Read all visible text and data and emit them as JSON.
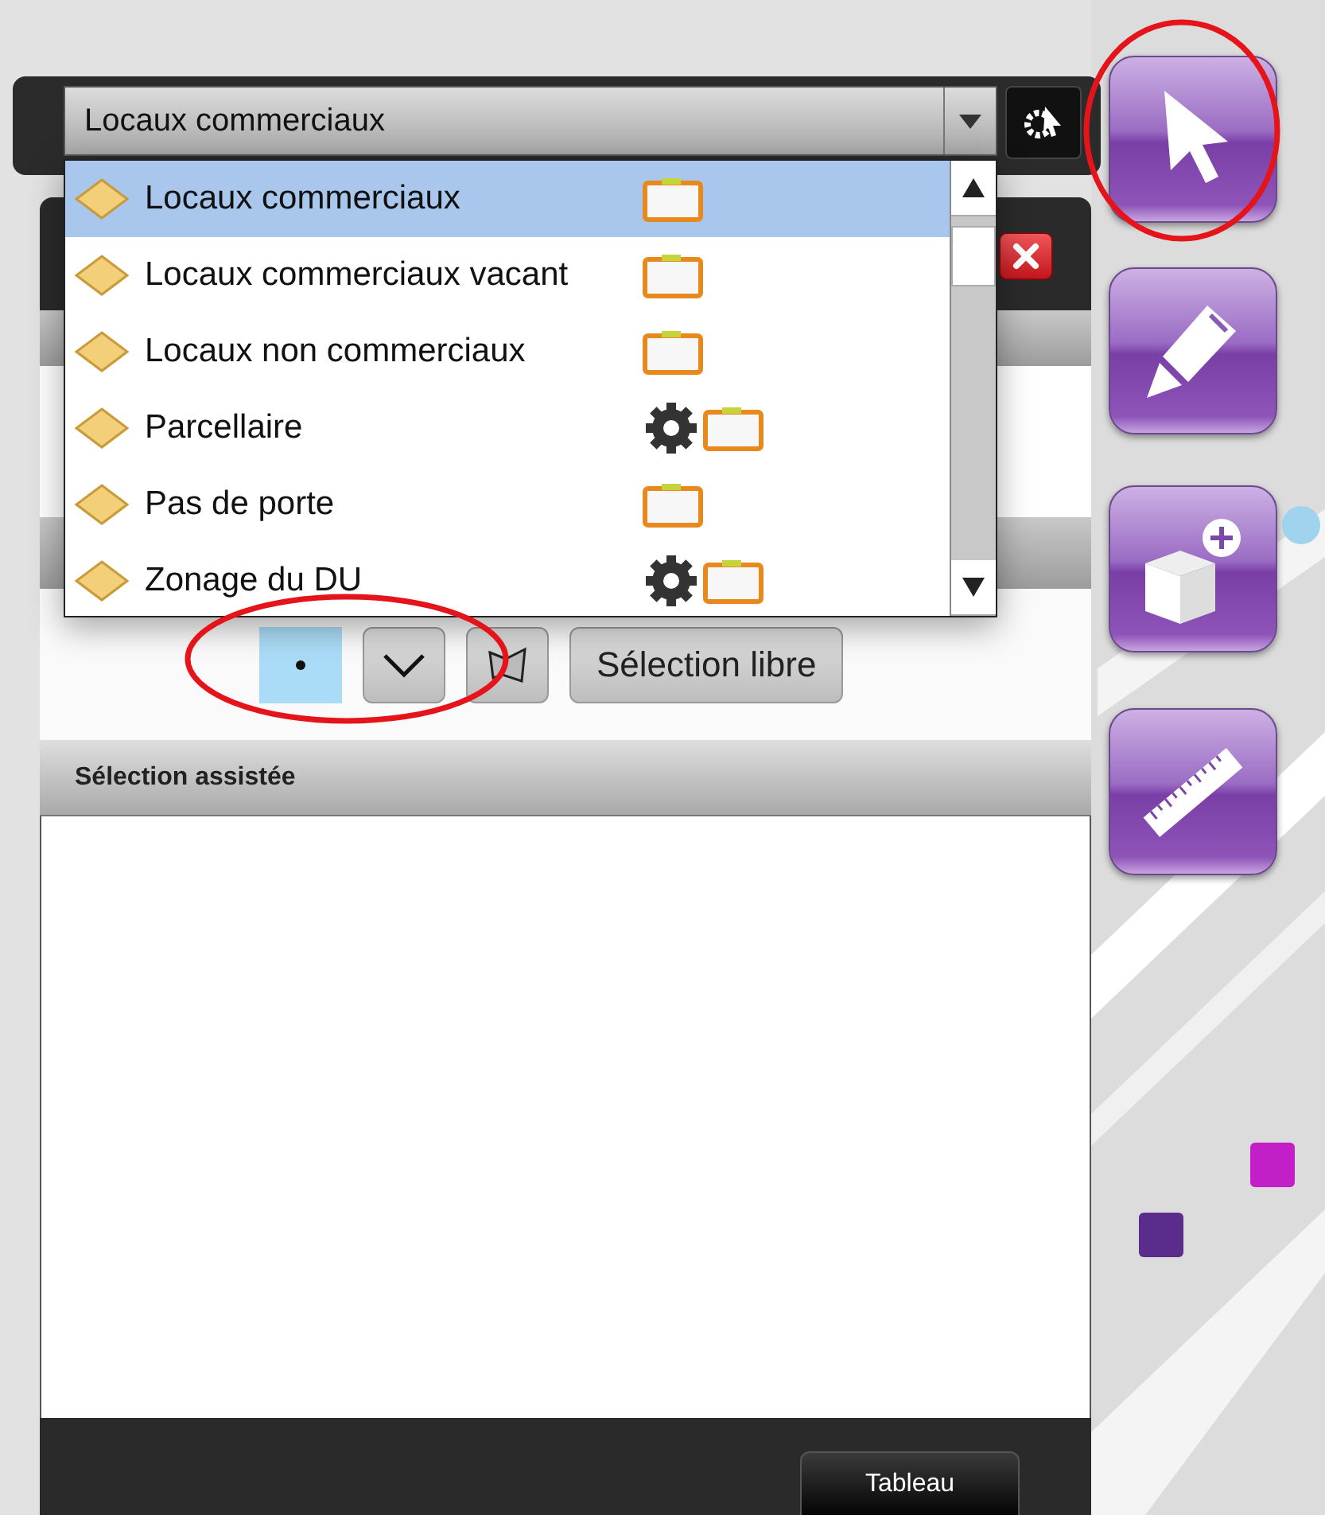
{
  "layer_select": {
    "value": "Locaux commerciaux"
  },
  "layer_list": {
    "items": [
      {
        "label": "Locaux commerciaux",
        "selected": true,
        "settings": false
      },
      {
        "label": "Locaux commerciaux vacant",
        "selected": false,
        "settings": false
      },
      {
        "label": "Locaux non commerciaux",
        "selected": false,
        "settings": false
      },
      {
        "label": "Parcellaire",
        "selected": false,
        "settings": true
      },
      {
        "label": "Pas de porte",
        "selected": false,
        "settings": false
      },
      {
        "label": "Zonage du DU",
        "selected": false,
        "settings": true
      }
    ]
  },
  "selection_modes": {
    "highlighted": true,
    "items": [
      {
        "kind": "point",
        "selected": true
      },
      {
        "kind": "line",
        "selected": false
      },
      {
        "kind": "polygon",
        "selected": false
      },
      {
        "kind": "free",
        "label": "Sélection libre",
        "selected": false
      }
    ]
  },
  "section_title": "Sélection assistée",
  "footer_button": "Tableau",
  "tools": [
    {
      "kind": "select",
      "highlighted": true
    },
    {
      "kind": "draw",
      "highlighted": false
    },
    {
      "kind": "add",
      "highlighted": false
    },
    {
      "kind": "measure",
      "highlighted": false
    }
  ]
}
